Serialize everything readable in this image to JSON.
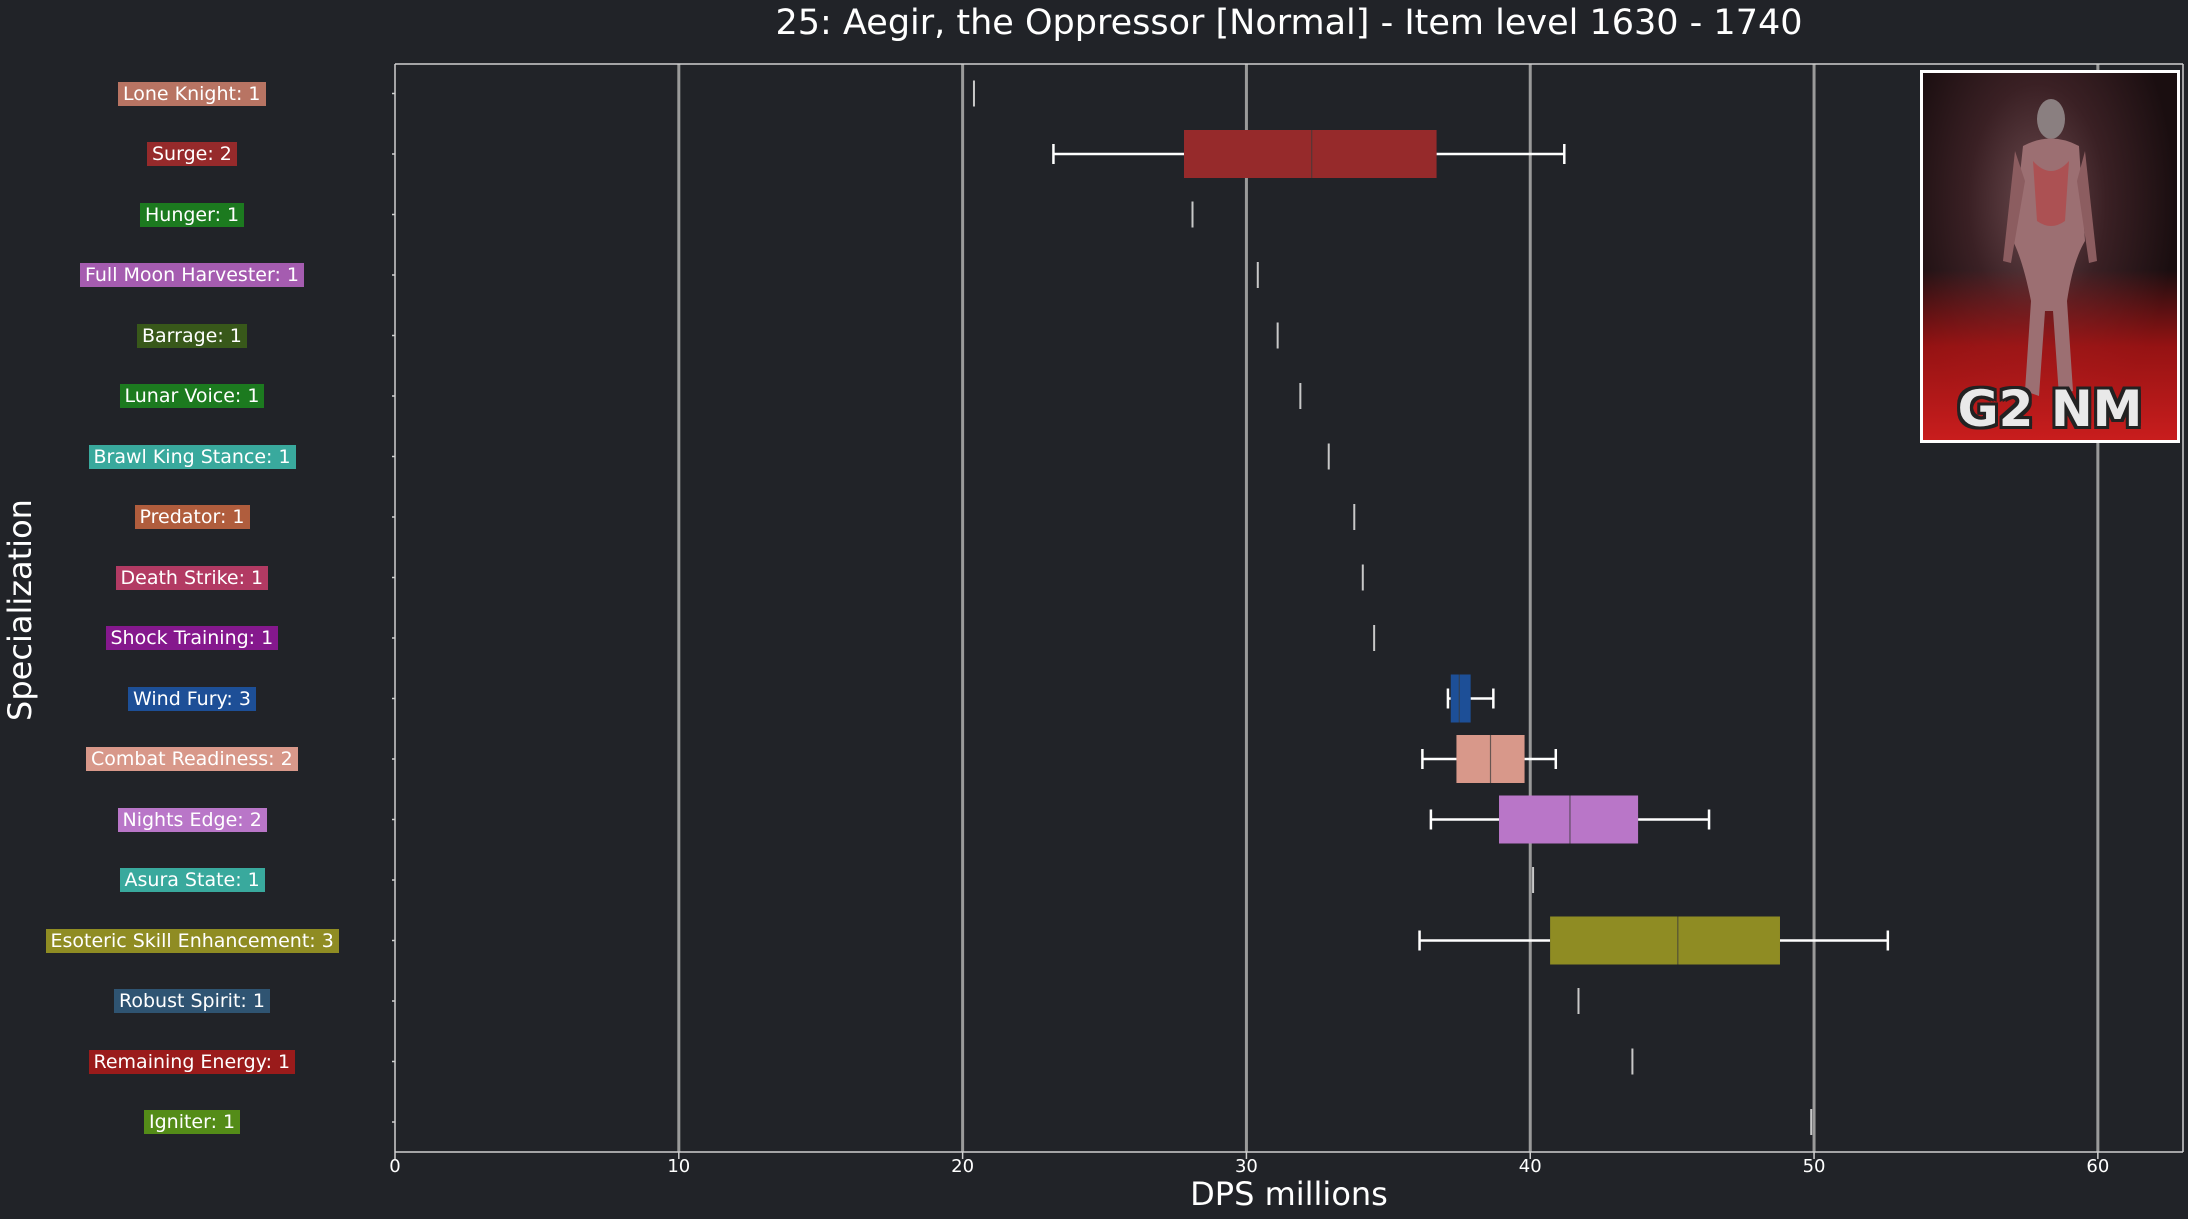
{
  "chart_data": {
    "type": "box",
    "title": "25: Aegir, the Oppressor [Normal] - Item level 1630 - 1740",
    "xlabel": "DPS millions",
    "ylabel": "Specialization",
    "xlim": [
      0,
      63
    ],
    "xticks": [
      0,
      10,
      20,
      30,
      40,
      50,
      60
    ],
    "grid": "vertical",
    "thumbnail_caption": "G2 NM",
    "series": [
      {
        "label": "Lone Knight: 1",
        "color": "#b87463",
        "min": 20.4,
        "q1": 20.4,
        "median": 20.4,
        "q3": 20.4,
        "max": 20.4
      },
      {
        "label": "Surge: 2",
        "color": "#962a2b",
        "min": 23.2,
        "q1": 27.8,
        "median": 32.3,
        "q3": 36.7,
        "max": 41.2
      },
      {
        "label": "Hunger: 1",
        "color": "#1c7a1f",
        "min": 28.1,
        "q1": 28.1,
        "median": 28.1,
        "q3": 28.1,
        "max": 28.1
      },
      {
        "label": "Full Moon Harvester: 1",
        "color": "#a55cb0",
        "min": 30.4,
        "q1": 30.4,
        "median": 30.4,
        "q3": 30.4,
        "max": 30.4
      },
      {
        "label": "Barrage: 1",
        "color": "#38581a",
        "min": 31.1,
        "q1": 31.1,
        "median": 31.1,
        "q3": 31.1,
        "max": 31.1
      },
      {
        "label": "Lunar Voice: 1",
        "color": "#1c7a1f",
        "min": 31.9,
        "q1": 31.9,
        "median": 31.9,
        "q3": 31.9,
        "max": 31.9
      },
      {
        "label": "Brawl King Stance: 1",
        "color": "#39a99d",
        "min": 32.9,
        "q1": 32.9,
        "median": 32.9,
        "q3": 32.9,
        "max": 32.9
      },
      {
        "label": "Predator: 1",
        "color": "#b05d3d",
        "min": 33.8,
        "q1": 33.8,
        "median": 33.8,
        "q3": 33.8,
        "max": 33.8
      },
      {
        "label": "Death Strike: 1",
        "color": "#b23a63",
        "min": 34.1,
        "q1": 34.1,
        "median": 34.1,
        "q3": 34.1,
        "max": 34.1
      },
      {
        "label": "Shock Training: 1",
        "color": "#85188d",
        "min": 34.5,
        "q1": 34.5,
        "median": 34.5,
        "q3": 34.5,
        "max": 34.5
      },
      {
        "label": "Wind Fury: 3",
        "color": "#1d4f97",
        "min": 37.1,
        "q1": 37.2,
        "median": 37.5,
        "q3": 37.9,
        "max": 38.7
      },
      {
        "label": "Combat Readiness: 2",
        "color": "#d8988a",
        "min": 36.2,
        "q1": 37.4,
        "median": 38.6,
        "q3": 39.8,
        "max": 40.9
      },
      {
        "label": "Nights Edge: 2",
        "color": "#b976c8",
        "min": 36.5,
        "q1": 38.9,
        "median": 41.4,
        "q3": 43.8,
        "max": 46.3
      },
      {
        "label": "Asura State: 1",
        "color": "#39a99d",
        "min": 40.1,
        "q1": 40.1,
        "median": 40.1,
        "q3": 40.1,
        "max": 40.1
      },
      {
        "label": "Esoteric Skill Enhancement: 3",
        "color": "#8f8c23",
        "min": 36.1,
        "q1": 40.7,
        "median": 45.2,
        "q3": 48.8,
        "max": 52.6
      },
      {
        "label": "Robust Spirit: 1",
        "color": "#2f5472",
        "min": 41.7,
        "q1": 41.7,
        "median": 41.7,
        "q3": 41.7,
        "max": 41.7
      },
      {
        "label": "Remaining Energy: 1",
        "color": "#9a1b1b",
        "min": 43.6,
        "q1": 43.6,
        "median": 43.6,
        "q3": 43.6,
        "max": 43.6
      },
      {
        "label": "Igniter: 1",
        "color": "#548c18",
        "min": 49.9,
        "q1": 49.9,
        "median": 49.9,
        "q3": 49.9,
        "max": 49.9
      }
    ]
  }
}
